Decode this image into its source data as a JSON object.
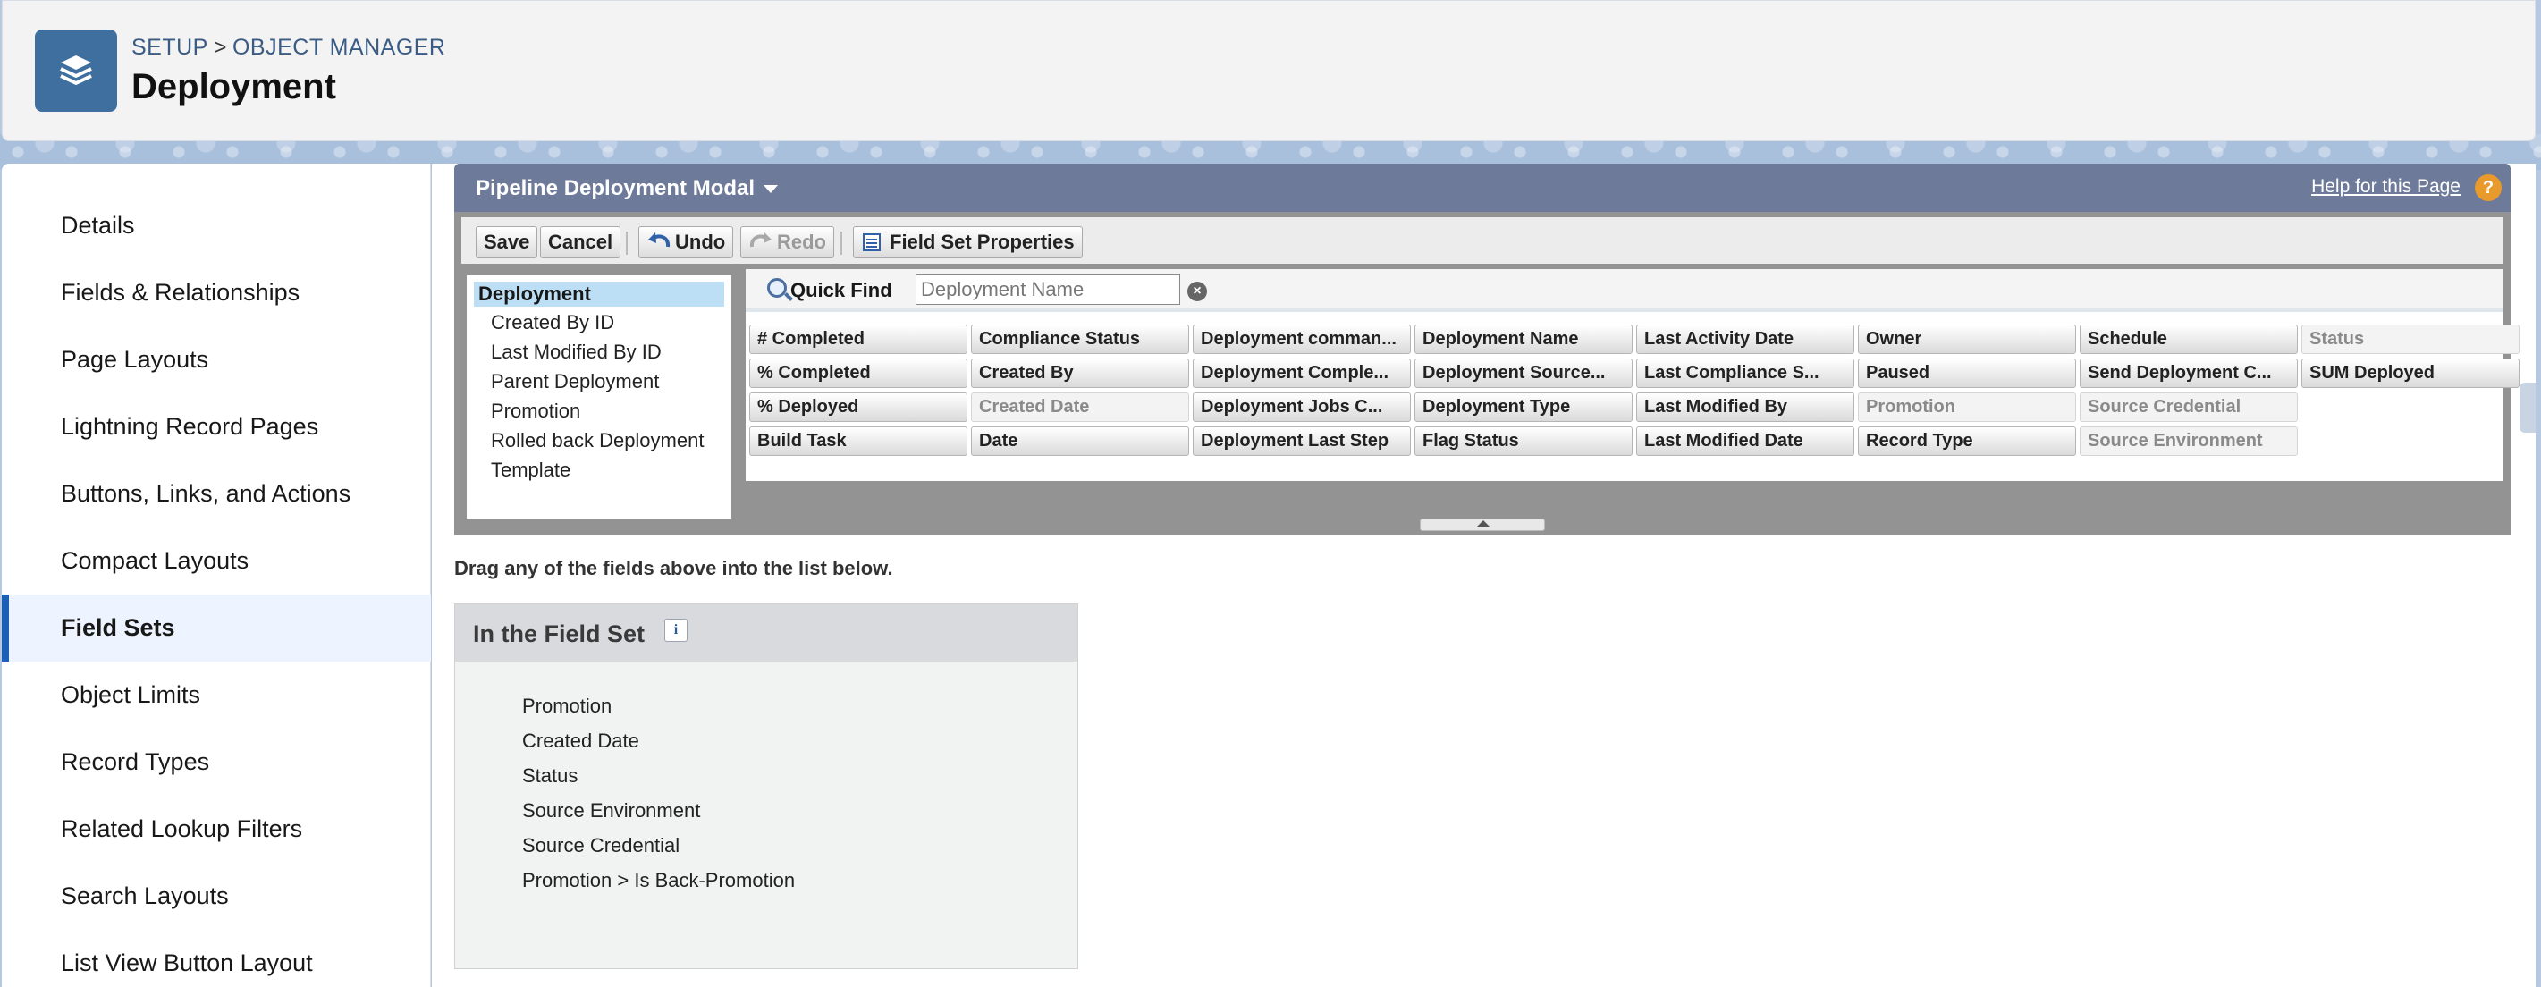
{
  "breadcrumb": {
    "setup": "SETUP",
    "sep": ">",
    "object_manager": "OBJECT MANAGER"
  },
  "page_title": "Deployment",
  "sidebar": {
    "items": [
      {
        "label": "Details",
        "active": false
      },
      {
        "label": "Fields & Relationships",
        "active": false
      },
      {
        "label": "Page Layouts",
        "active": false
      },
      {
        "label": "Lightning Record Pages",
        "active": false
      },
      {
        "label": "Buttons, Links, and Actions",
        "active": false
      },
      {
        "label": "Compact Layouts",
        "active": false
      },
      {
        "label": "Field Sets",
        "active": true
      },
      {
        "label": "Object Limits",
        "active": false
      },
      {
        "label": "Record Types",
        "active": false
      },
      {
        "label": "Related Lookup Filters",
        "active": false
      },
      {
        "label": "Search Layouts",
        "active": false
      },
      {
        "label": "List View Button Layout",
        "active": false
      }
    ]
  },
  "editor": {
    "title": "Pipeline Deployment Modal",
    "help_link": "Help for this Page",
    "help_icon": "?",
    "toolbar": {
      "save": "Save",
      "cancel": "Cancel",
      "undo": "Undo",
      "redo": "Redo",
      "field_set_properties": "Field Set Properties"
    },
    "tree": {
      "root": "Deployment",
      "items": [
        "Created By ID",
        "Last Modified By ID",
        "Parent Deployment",
        "Promotion",
        "Rolled back Deployment",
        "Template"
      ]
    },
    "quick_find": {
      "label": "Quick Find",
      "placeholder": "Deployment Name"
    },
    "fields": [
      [
        "# Completed",
        "Compliance Status",
        "Deployment comman...",
        "Deployment Name",
        "Last Activity Date",
        "Owner",
        "Schedule",
        "Status"
      ],
      [
        "% Completed",
        "Created By",
        "Deployment Comple...",
        "Deployment Source...",
        "Last Compliance S...",
        "Paused",
        "Send Deployment C...",
        "SUM Deployed"
      ],
      [
        "% Deployed",
        "Created Date",
        "Deployment Jobs C...",
        "Deployment Type",
        "Last Modified By",
        "Promotion",
        "Source Credential"
      ],
      [
        "Build Task",
        "Date",
        "Deployment Last Step",
        "Flag Status",
        "Last Modified Date",
        "Record Type",
        "Source Environment"
      ]
    ],
    "used_fields": [
      "Status",
      "Created Date",
      "Promotion",
      "Source Credential",
      "Source Environment"
    ]
  },
  "drag_hint": "Drag any of the fields above into the list below.",
  "field_set": {
    "title": "In the Field Set",
    "info_icon": "i",
    "items": [
      "Promotion",
      "Created Date",
      "Status",
      "Source Environment",
      "Source Credential",
      "Promotion > Is Back-Promotion"
    ]
  },
  "colors": {
    "header_blue": "#6e7a99",
    "app_icon": "#3e6f9e",
    "link": "#3a5c84",
    "help": "#e99a2c",
    "active_bar": "#1b5fb8"
  }
}
